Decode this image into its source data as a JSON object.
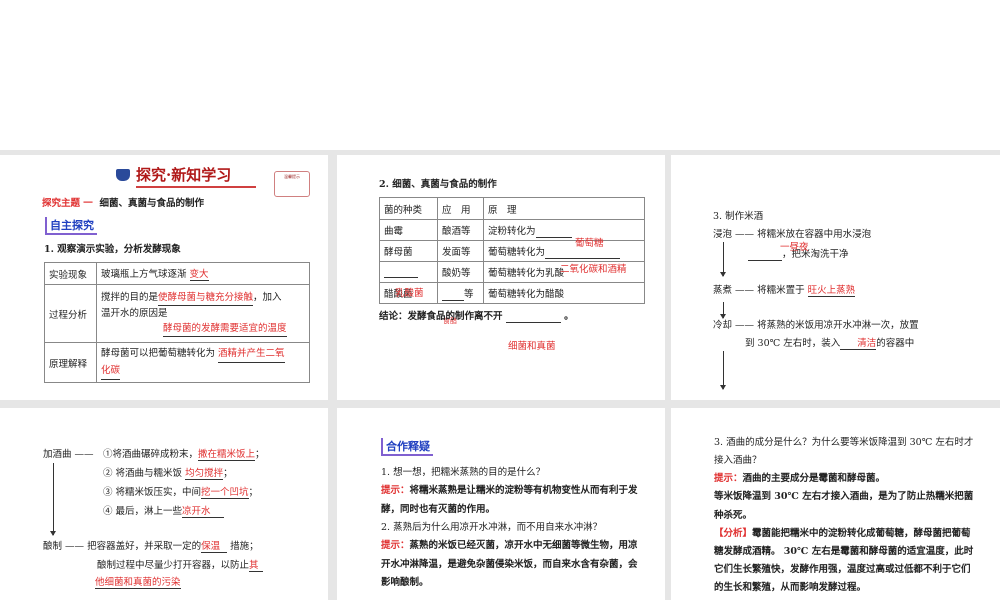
{
  "slide1": {
    "banner": "探究·新知学习",
    "note": "温馨提示",
    "topic_label": "探究主题 一",
    "topic": "细菌、真菌与食品的制作",
    "section": "自主探究",
    "q1": "1. 观察演示实验，分析发酵现象",
    "rows": [
      {
        "head": "实验现象",
        "text": "玻璃瓶上方气球逐渐",
        "ans": "变大"
      },
      {
        "head": "过程分析",
        "text1": "搅拌的目的是",
        "ans1": "使酵母菌与糖充分接触",
        "text1b": "，加入",
        "text2": "温开水的原因是",
        "ans2": "酵母菌的发酵需要适宜的温度"
      },
      {
        "head": "原理解释",
        "text": "酵母菌可以把葡萄糖转化为",
        "ans": "酒精并产生二氧",
        "ans_cont": "化碳"
      }
    ]
  },
  "slide2": {
    "heading": "2. 细菌、真菌与食品的制作",
    "header": [
      "菌的种类",
      "应　用",
      "原　理"
    ],
    "rows": [
      [
        "曲霉",
        "酿酒等",
        "淀粉转化为"
      ],
      [
        "酵母菌",
        "发面等",
        "葡萄糖转化为"
      ],
      [
        "",
        "酸奶等",
        "葡萄糖转化为乳酸"
      ],
      [
        "醋酸菌",
        "等",
        "葡萄糖转化为醋酸"
      ]
    ],
    "answers": {
      "a1": "葡萄糖",
      "a2": "二氧化碳和酒精",
      "a3": "乳酸菌",
      "a4": "食醋",
      "a5": "细菌和真菌"
    },
    "conclusion": "结论：发酵食品的制作离不开"
  },
  "slide3": {
    "heading": "3. 制作米酒",
    "s1": "浸泡",
    "s1_t1": "将糯米放在容器中用水浸泡",
    "s1_t2": "，把米淘洗干净",
    "s1_ans": "一昼夜",
    "s2": "蒸煮",
    "s2_t": "将糯米置于",
    "s2_ans": "旺火上蒸熟",
    "s3": "冷却",
    "s3_t1": "将蒸熟的米饭用凉开水冲淋一次，放置",
    "s3_t2a": "到 30℃ 左右时，装入",
    "s3_t2b": "的容器中",
    "s3_ans": "清洁",
    "dash": "——"
  },
  "slide4": {
    "s1": "加酒曲",
    "dash": "——",
    "steps": [
      {
        "t": "①将酒曲碾碎成粉末，",
        "a": "撒在糯米饭上",
        "e": "；"
      },
      {
        "t": "② 将酒曲与糯米饭",
        "a": "均匀搅拌",
        "e": "；"
      },
      {
        "t": "③ 将糯米饭压实，中间",
        "a": "挖一个凹坑",
        "e": "；"
      },
      {
        "t": "④ 最后，淋上一些",
        "a": "凉开水",
        "e": ""
      }
    ],
    "s2": "酿制",
    "s2_t1": "把容器盖好，并采取一定的",
    "s2_a1": "保温",
    "s2_t1b": "措施；",
    "s2_t2": "酿制过程中尽量少打开容器，以防止",
    "s2_a2": "其",
    "s2_a3": "他细菌和真菌的污染"
  },
  "slide5": {
    "section": "合作释疑",
    "q1": "1. 想一想，把糯米蒸熟的目的是什么？",
    "hint": "提示：",
    "a1a": "将糯米蒸熟是让糯米的淀粉等有机物变性从而有利于发",
    "a1b": "酵，同时也有灭菌的作用。",
    "q2": "2. 蒸熟后为什么用凉开水冲淋，而不用自来水冲淋？",
    "a2a": "蒸熟的米饭已经灭菌，凉开水中无细菌等微生物，用凉",
    "a2b": "开水冲淋降温，是避免杂菌侵染米饭，而自来水含有杂菌，会",
    "a2c": "影响酿制。"
  },
  "slide6": {
    "q3a": "3. 酒曲的成分是什么？为什么要等米饭降温到 30℃ 左右时才",
    "q3b": "接入酒曲？",
    "hint": "提示：",
    "a1": "酒曲的主要成分是霉菌和酵母菌。",
    "a2a": "等米饭降温到 30℃ 左右才接入酒曲，是为了防止热糯米把菌",
    "a2b": "种杀死。",
    "analysis": "【分析】",
    "an1": "霉菌能把糯米中的淀粉转化成葡萄糖，酵母菌把葡萄",
    "an2": "糖发酵成酒精。 30℃ 左右是霉菌和酵母菌的适宜温度，此时",
    "an3": "它们生长繁殖快，发酵作用强，温度过高或过低都不利于它们",
    "an4": "的生长和繁殖，从而影响发酵过程。"
  }
}
